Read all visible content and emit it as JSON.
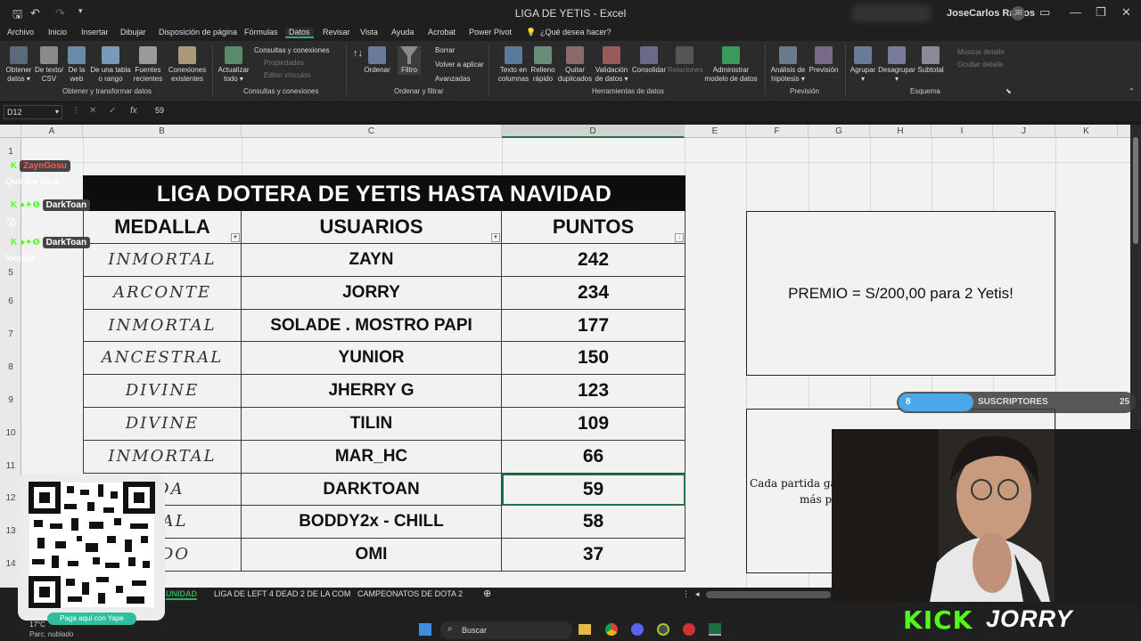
{
  "window": {
    "title": "LIGA DE YETIS  -  Excel",
    "user_name": "JoseCarlos Ramos",
    "user_initials": "JR"
  },
  "menu": {
    "items": [
      "Archivo",
      "Inicio",
      "Insertar",
      "Dibujar",
      "Disposición de página",
      "Fórmulas",
      "Datos",
      "Revisar",
      "Vista",
      "Ayuda",
      "Acrobat",
      "Power Pivot"
    ],
    "active": "Datos",
    "tell_me": "¿Qué desea hacer?"
  },
  "ribbon": {
    "buttons": {
      "obtener": "Obtener\ndatos ▾",
      "texto_csv": "De texto/\nCSV",
      "web": "De la\nweb",
      "tabla": "De una tabla\no rango",
      "fuentes": "Fuentes\nrecientes",
      "conexiones": "Conexiones\nexistentes",
      "actualizar": "Actualizar\ntodo ▾",
      "ordenar": "Ordenar",
      "filtro": "Filtro",
      "texto_col": "Texto en\ncolumnas",
      "relleno": "Relleno\nrápido",
      "quitar": "Quitar\nduplicados",
      "validacion": "Validación\nde datos ▾",
      "consolidar": "Consolidar",
      "relaciones": "Relaciones",
      "modelo": "Administrar\nmodelo de datos",
      "hipotesis": "Análisis de\nhipótesis ▾",
      "prevision": "Previsión",
      "agrupar": "Agrupar\n▾",
      "desagrupar": "Desagrupar\n▾",
      "subtotal": "Subtotal"
    },
    "small": {
      "consultas": "Consultas y conexiones",
      "propiedades": "Propiedades",
      "editar_vinculos": "Editar vínculos",
      "borrar": "Borrar",
      "volver": "Volver a aplicar",
      "avanzadas": "Avanzadas",
      "mostrar": "Mostrar detalle",
      "ocultar": "Ocultar detalle"
    },
    "groups": {
      "obtener": "Obtener y transformar datos",
      "consultas": "Consultas y conexiones",
      "ordenar": "Ordenar y filtrar",
      "herramientas": "Herramientas de datos",
      "prevision": "Previsión",
      "esquema": "Esquema"
    }
  },
  "formula_bar": {
    "name_box": "D12",
    "value": "59"
  },
  "columns": [
    "A",
    "B",
    "C",
    "D",
    "E",
    "F",
    "G",
    "H",
    "I",
    "J",
    "K"
  ],
  "selected_column": "D",
  "rows": [
    "1",
    "2",
    "3",
    "4",
    "5",
    "6",
    "7",
    "8",
    "9",
    "10",
    "11",
    "12",
    "13",
    "14"
  ],
  "league": {
    "title": "LIGA DOTERA DE YETIS HASTA NAVIDAD",
    "headers": {
      "medalla": "MEDALLA",
      "usuarios": "USUARIOS",
      "puntos": "PUNTOS"
    },
    "entries": [
      {
        "medalla": "INMORTAL",
        "usuario": "ZAYN",
        "puntos": "242"
      },
      {
        "medalla": "ARCONTE",
        "usuario": "JORRY",
        "puntos": "234"
      },
      {
        "medalla": "INMORTAL",
        "usuario": "SOLADE . MOSTRO PAPI",
        "puntos": "177"
      },
      {
        "medalla": "ANCESTRAL",
        "usuario": "YUNIOR",
        "puntos": "150"
      },
      {
        "medalla": "DIVINE",
        "usuario": "JHERRY G",
        "puntos": "123"
      },
      {
        "medalla": "DIVINE",
        "usuario": "TILIN",
        "puntos": "109"
      },
      {
        "medalla": "INMORTAL",
        "usuario": "MAR_HC",
        "puntos": "66"
      },
      {
        "medalla": "NDA",
        "usuario": "DARKTOAN",
        "puntos": "59"
      },
      {
        "medalla": "RTAL",
        "usuario": "BODDY2x - CHILL",
        "puntos": "58"
      },
      {
        "medalla": "ALDO",
        "usuario": "OMI",
        "puntos": "37"
      }
    ]
  },
  "prize_box": {
    "text": "PREMIO = S/200,00  para 2 Yetis!"
  },
  "info_box": {
    "line1": "Cada partida gan",
    "line2": "más puntos"
  },
  "sheet_tabs": {
    "tabs": [
      "UNIDAD",
      "LIGA DE LEFT 4 DEAD 2 DE LA COM",
      "CAMPEONATOS DE DOTA 2"
    ],
    "active": "UNIDAD"
  },
  "chat": [
    {
      "user": "ZaynGosu",
      "message": "Que fue loca",
      "color": "#ff5a5a"
    },
    {
      "user": "DarkToan",
      "message": "",
      "color": "#ffffff"
    },
    {
      "user": "DarkToan",
      "message": "loquita",
      "color": "#ffffff"
    }
  ],
  "qr": {
    "button": "Paga aquí con Yape"
  },
  "subscribers": {
    "current": "8",
    "label": "SUSCRIPTORES",
    "goal": "25",
    "progress": 0.32
  },
  "stream": {
    "platform": "KICK",
    "streamer": "JORRY"
  },
  "taskbar": {
    "search": "Buscar",
    "weather_temp": "17°C",
    "weather_desc": "Parc. nublado"
  },
  "colors": {
    "excel_green": "#217346",
    "kick_green": "#53fc18"
  }
}
